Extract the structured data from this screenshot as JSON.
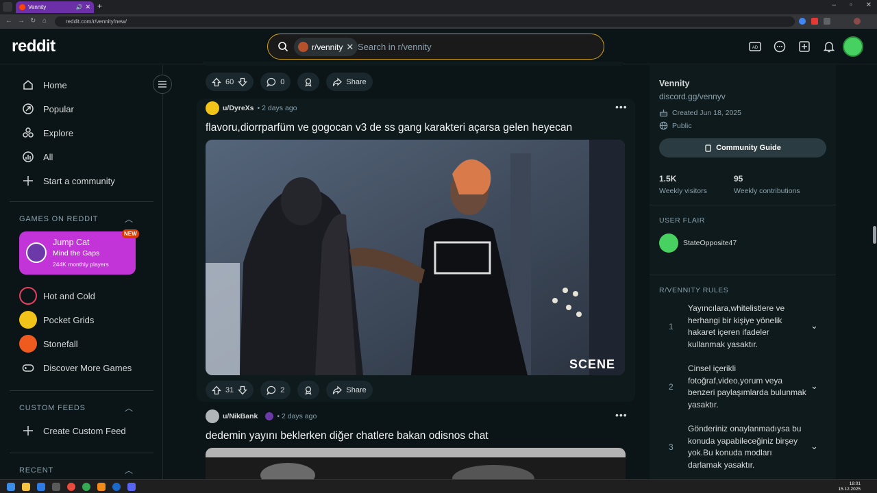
{
  "browser": {
    "tab_title": "Vennity",
    "new_tab_symbol": "+",
    "url": "reddit.com/r/vennity/new/",
    "win_min": "–",
    "win_max": "▫",
    "win_close": "✕"
  },
  "header": {
    "logo": "reddit",
    "search_chip": "r/vennity",
    "search_placeholder": "Search in r/vennity"
  },
  "left_nav": {
    "items": [
      {
        "label": "Home",
        "icon": "home-icon"
      },
      {
        "label": "Popular",
        "icon": "popular-icon"
      },
      {
        "label": "Explore",
        "icon": "explore-icon"
      },
      {
        "label": "All",
        "icon": "all-icon"
      },
      {
        "label": "Start a community",
        "icon": "plus-icon"
      }
    ],
    "games_section": "GAMES ON REDDIT",
    "featured_game": {
      "name": "Jump Cat",
      "tagline": "Mind the Gaps",
      "players": "244K monthly players",
      "badge": "NEW"
    },
    "games": [
      {
        "label": "Hot and Cold"
      },
      {
        "label": "Pocket Grids"
      },
      {
        "label": "Stonefall"
      },
      {
        "label": "Discover More Games"
      }
    ],
    "custom_feeds_section": "CUSTOM FEEDS",
    "create_feed": "Create Custom Feed",
    "recent_section": "RECENT"
  },
  "feed": {
    "top_actions": {
      "votes": "60",
      "comments": "0",
      "share": "Share"
    },
    "posts": [
      {
        "user": "u/DyreXs",
        "time": "• 2 days ago",
        "title": "flavoru,diorrparfüm ve gogocan v3 de ss gang karakteri açarsa gelen heyecan",
        "media_watermark": "SCENE",
        "votes": "31",
        "comments": "2",
        "share": "Share"
      },
      {
        "user": "u/NikBank",
        "time": "• 2 days ago",
        "title": "dedemin yayını beklerken diğer chatlere bakan odisnos chat"
      }
    ]
  },
  "right_sidebar": {
    "name": "Vennity",
    "link": "discord.gg/vennyv",
    "created": "Created Jun 18, 2025",
    "visibility": "Public",
    "guide_button": "Community Guide",
    "stats": [
      {
        "value": "1.5K",
        "label": "Weekly visitors"
      },
      {
        "value": "95",
        "label": "Weekly contributions"
      }
    ],
    "flair_section": "USER FLAIR",
    "flair_user": "StateOpposite47",
    "rules_section": "R/VENNITY RULES",
    "rules": [
      {
        "num": "1",
        "text": "Yayıncılara,whitelistlere ve herhangi bir kişiye yönelik hakaret içeren ifadeler kullanmak yasaktır."
      },
      {
        "num": "2",
        "text": "Cinsel içerikli fotoğraf,video,yorum veya benzeri paylaşımlarda bulunmak yasaktır."
      },
      {
        "num": "3",
        "text": "Gönderiniz onaylanmadıysa bu konuda yapabileceğiniz birşey yok.Bu konuda modları darlamak yasaktır."
      }
    ]
  },
  "taskbar": {
    "time": "18:01",
    "date": "15.12.2025"
  },
  "colors": {
    "background": "#0b1416",
    "card": "#0f1a1c",
    "search_border": "#d4a514",
    "featured_game": "#c334d8",
    "avatar_green": "#46d160"
  }
}
